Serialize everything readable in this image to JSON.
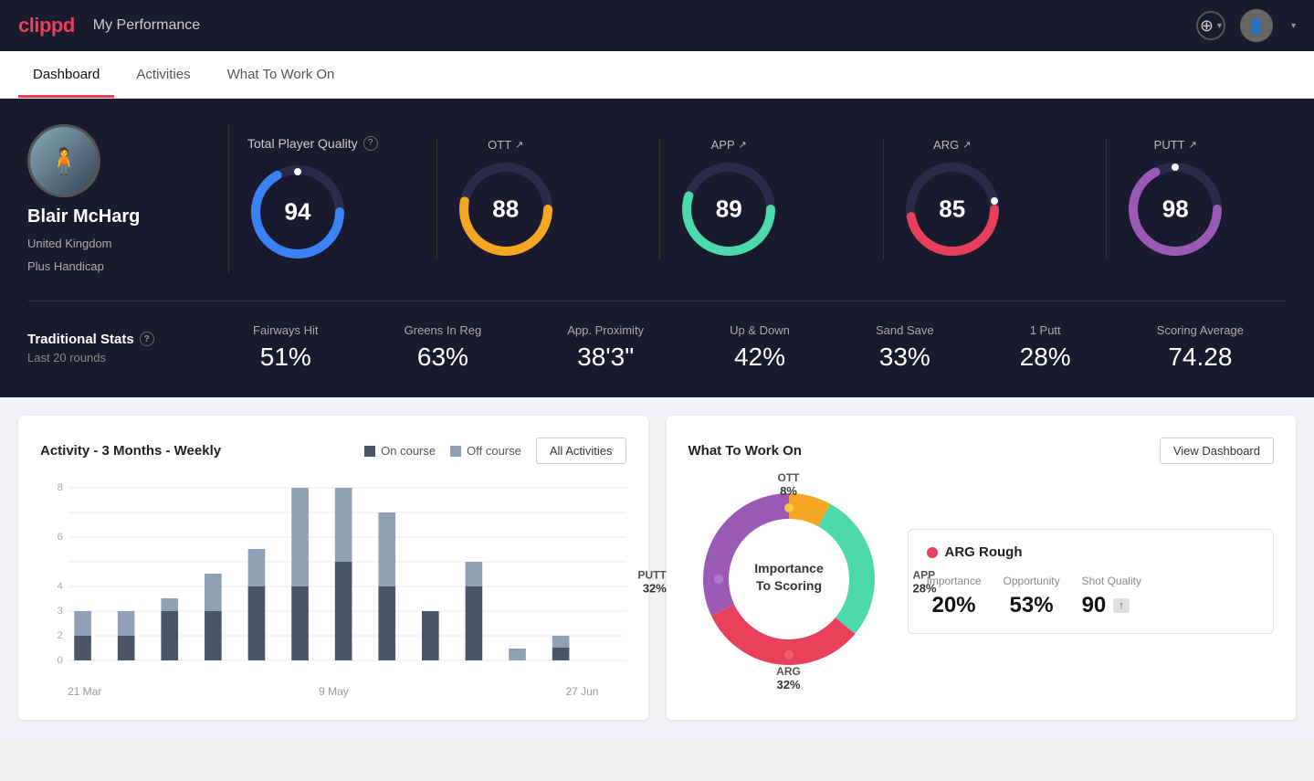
{
  "app": {
    "logo": "clippd",
    "nav_title": "My Performance",
    "add_icon": "+",
    "chevron": "▾"
  },
  "tabs": [
    {
      "id": "dashboard",
      "label": "Dashboard",
      "active": true
    },
    {
      "id": "activities",
      "label": "Activities",
      "active": false
    },
    {
      "id": "what-to-work-on",
      "label": "What To Work On",
      "active": false
    }
  ],
  "player": {
    "name": "Blair McHarg",
    "country": "United Kingdom",
    "handicap": "Plus Handicap"
  },
  "total_player_quality": {
    "label": "Total Player Quality",
    "value": 94,
    "color": "#3b82f6"
  },
  "gauges": [
    {
      "id": "ott",
      "label": "OTT",
      "value": 88,
      "color": "#f5a623",
      "percent": 78
    },
    {
      "id": "app",
      "label": "APP",
      "value": 89,
      "color": "#4dd9ac",
      "percent": 80
    },
    {
      "id": "arg",
      "label": "ARG",
      "value": 85,
      "color": "#e8405a",
      "percent": 72
    },
    {
      "id": "putt",
      "label": "PUTT",
      "value": 98,
      "color": "#9b59b6",
      "percent": 92
    }
  ],
  "traditional_stats": {
    "title": "Traditional Stats",
    "subtitle": "Last 20 rounds",
    "stats": [
      {
        "label": "Fairways Hit",
        "value": "51%"
      },
      {
        "label": "Greens In Reg",
        "value": "63%"
      },
      {
        "label": "App. Proximity",
        "value": "38'3\""
      },
      {
        "label": "Up & Down",
        "value": "42%"
      },
      {
        "label": "Sand Save",
        "value": "33%"
      },
      {
        "label": "1 Putt",
        "value": "28%"
      },
      {
        "label": "Scoring Average",
        "value": "74.28"
      }
    ]
  },
  "activity_chart": {
    "title": "Activity - 3 Months - Weekly",
    "legend": [
      {
        "label": "On course",
        "color": "#4a5568"
      },
      {
        "label": "Off course",
        "color": "#90a0b7"
      }
    ],
    "all_activities_label": "All Activities",
    "x_labels": [
      "21 Mar",
      "9 May",
      "27 Jun"
    ],
    "bars": [
      {
        "on": 1,
        "off": 1
      },
      {
        "on": 1,
        "off": 1
      },
      {
        "on": 2,
        "off": 0.5
      },
      {
        "on": 2,
        "off": 1.5
      },
      {
        "on": 3,
        "off": 1.5
      },
      {
        "on": 3,
        "off": 5
      },
      {
        "on": 4,
        "off": 4.5
      },
      {
        "on": 2.5,
        "off": 3
      },
      {
        "on": 2,
        "off": 0
      },
      {
        "on": 3,
        "off": 1
      },
      {
        "on": 0,
        "off": 0.5
      },
      {
        "on": 0.5,
        "off": 0.5
      }
    ]
  },
  "what_to_work_on": {
    "title": "What To Work On",
    "view_dashboard_label": "View Dashboard",
    "donut": {
      "center_text": "Importance\nTo Scoring",
      "segments": [
        {
          "label": "OTT",
          "value": 8,
          "color": "#f5a623",
          "percent": 8
        },
        {
          "label": "APP",
          "value": 28,
          "color": "#4dd9ac",
          "percent": 28
        },
        {
          "label": "ARG",
          "value": 32,
          "color": "#e8405a",
          "percent": 32
        },
        {
          "label": "PUTT",
          "value": 32,
          "color": "#9b59b6",
          "percent": 32
        }
      ]
    },
    "detail_card": {
      "title": "ARG Rough",
      "dot_color": "#e8405a",
      "metrics": [
        {
          "label": "Importance",
          "value": "20%"
        },
        {
          "label": "Opportunity",
          "value": "53%"
        },
        {
          "label": "Shot Quality",
          "value": "90",
          "badge": ""
        }
      ]
    }
  }
}
